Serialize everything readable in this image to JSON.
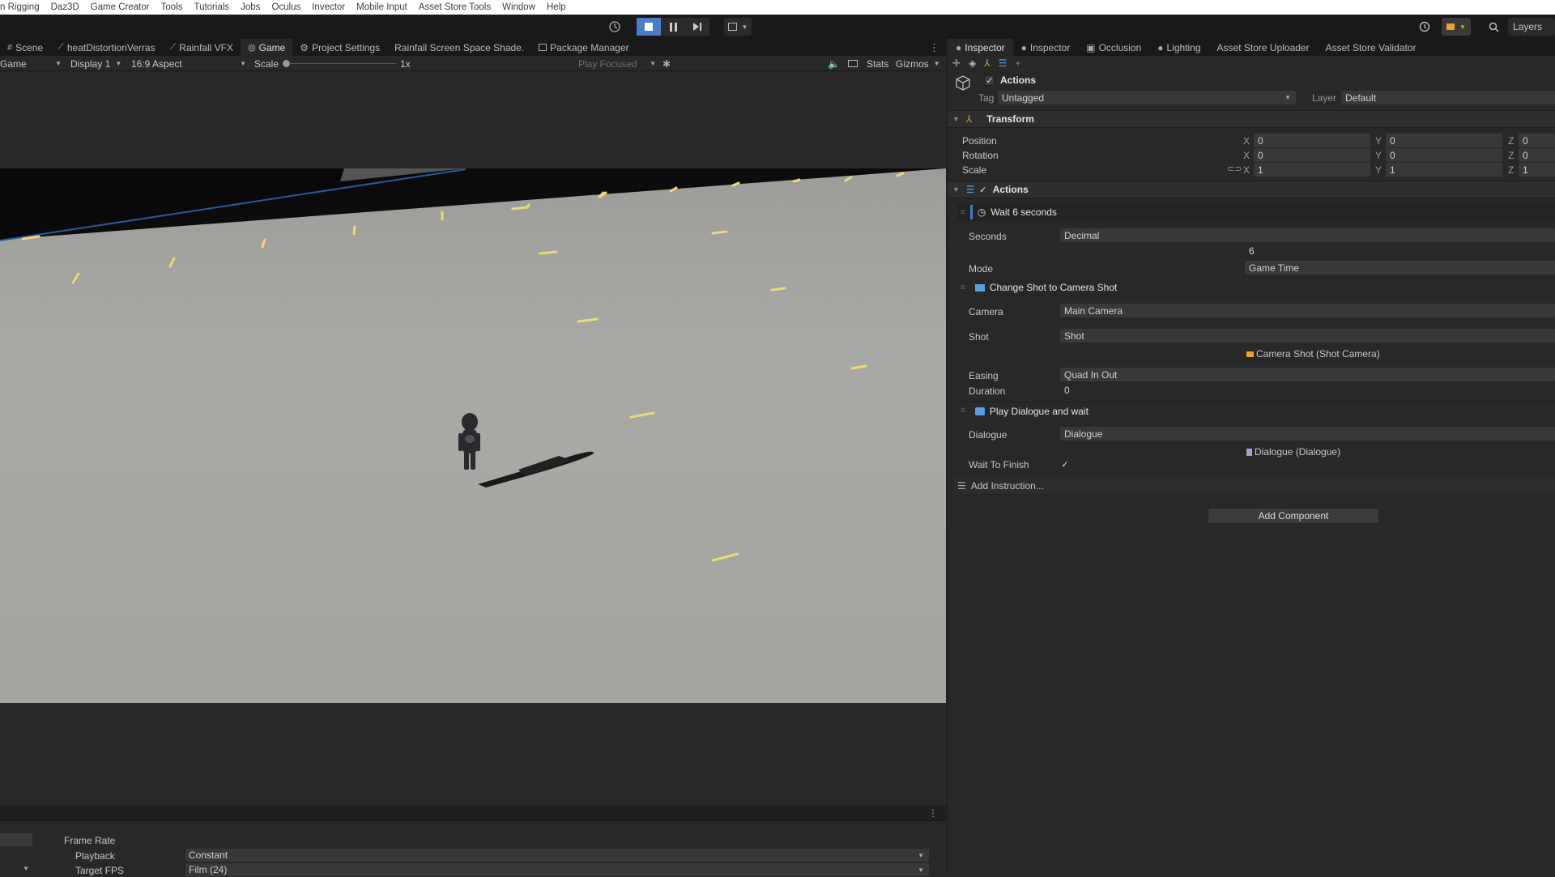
{
  "menu": [
    "n Rigging",
    "Daz3D",
    "Game Creator",
    "Tools",
    "Tutorials",
    "Jobs",
    "Oculus",
    "Invector",
    "Mobile Input",
    "Asset Store Tools",
    "Window",
    "Help"
  ],
  "toolbar": {
    "layers_label": "Layers"
  },
  "game_tabs": [
    {
      "icon": "grid-icon",
      "label": "Scene"
    },
    {
      "icon": "shader-icon",
      "label": "heatDistortionVerras"
    },
    {
      "icon": "shader-icon",
      "label": "Rainfall VFX"
    },
    {
      "icon": "gamepad-icon",
      "label": "Game"
    },
    {
      "icon": "gear-icon",
      "label": "Project Settings"
    },
    {
      "icon": "",
      "label": "Rainfall Screen Space Shade."
    },
    {
      "icon": "package-icon",
      "label": "Package Manager"
    }
  ],
  "game_toolbar": {
    "mode": "Game",
    "display": "Display 1",
    "aspect": "16:9 Aspect",
    "scale_label": "Scale",
    "scale_value": "1x",
    "play_mode": "Play Focused",
    "stats": "Stats",
    "gizmos": "Gizmos"
  },
  "bottom": {
    "frame_rate": "Frame Rate",
    "playback_label": "Playback",
    "playback_value": "Constant",
    "target_fps_label": "Target FPS",
    "target_fps_value": "Film (24)"
  },
  "inspector": {
    "tabs": [
      {
        "icon": "info-icon",
        "label": "Inspector"
      },
      {
        "icon": "info-icon",
        "label": "Inspector"
      },
      {
        "icon": "occlusion-icon",
        "label": "Occlusion"
      },
      {
        "icon": "bulb-icon",
        "label": "Lighting"
      },
      {
        "icon": "",
        "label": "Asset Store Uploader"
      },
      {
        "icon": "",
        "label": "Asset Store Validator"
      }
    ],
    "object_name": "Actions",
    "tag_label": "Tag",
    "tag_value": "Untagged",
    "layer_label": "Layer",
    "layer_value": "Default",
    "transform": {
      "title": "Transform",
      "position_label": "Position",
      "rotation_label": "Rotation",
      "scale_label": "Scale",
      "x": "X",
      "y": "Y",
      "z": "Z",
      "position": [
        "0",
        "0",
        "0"
      ],
      "rotation": [
        "0",
        "0",
        "0"
      ],
      "scale": [
        "1",
        "1",
        "1"
      ]
    },
    "actions": {
      "title": "Actions",
      "wait": {
        "title": "Wait 6 seconds",
        "seconds_label": "Seconds",
        "seconds_type": "Decimal",
        "seconds_value": "6",
        "mode_label": "Mode",
        "mode_value": "Game Time"
      },
      "shot": {
        "title": "Change Shot to Camera Shot",
        "camera_label": "Camera",
        "camera_value": "Main Camera",
        "shot_label": "Shot",
        "shot_value": "Shot",
        "shot_ref": "Camera Shot (Shot Camera)",
        "easing_label": "Easing",
        "easing_value": "Quad In Out",
        "duration_label": "Duration",
        "duration_value": "0"
      },
      "dialogue": {
        "title": "Play Dialogue and wait",
        "dialogue_label": "Dialogue",
        "dialogue_value": "Dialogue",
        "dialogue_ref": "Dialogue (Dialogue)",
        "wait_label": "Wait To Finish"
      },
      "add_instruction": "Add Instruction..."
    },
    "add_component": "Add Component"
  },
  "colors": {
    "accent": "#4a7dc6",
    "panel": "#282828",
    "tabbar": "#191919",
    "field": "#383838"
  }
}
